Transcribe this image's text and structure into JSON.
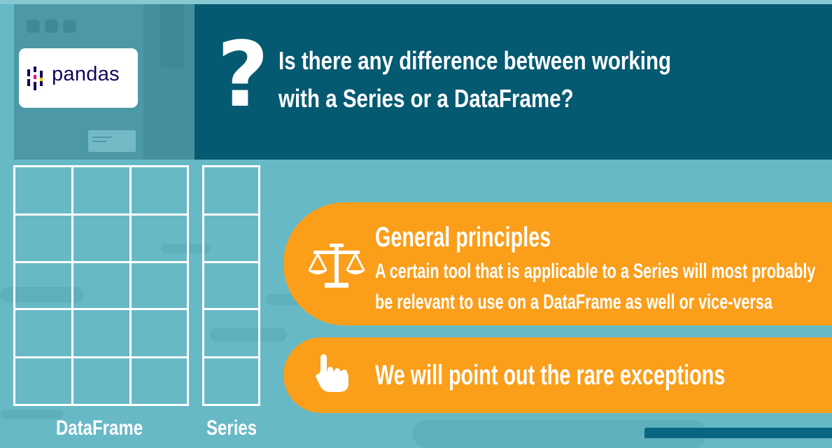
{
  "logo": {
    "text": "pandas",
    "mark_icon": "pandas-logo-icon",
    "brand_color": "#150458"
  },
  "question": {
    "icon": "question-mark-icon",
    "mark": "?",
    "line1": "Is there any difference between working",
    "line2": "with a Series or a DataFrame?"
  },
  "diagram": {
    "dataframe_label": "DataFrame",
    "series_label": "Series"
  },
  "principles": {
    "icon": "balance-scale-icon",
    "title": "General principles",
    "line1": "A certain tool that is applicable to a Series will most probably",
    "line2": "be relevant to use on a DataFrame as well or vice-versa"
  },
  "exceptions": {
    "icon": "pointing-hand-icon",
    "text": "We will point out the rare exceptions"
  },
  "colors": {
    "background": "#67b9c6",
    "banner": "#055a72",
    "accent_orange": "#fb9e1a",
    "white": "#ffffff"
  }
}
